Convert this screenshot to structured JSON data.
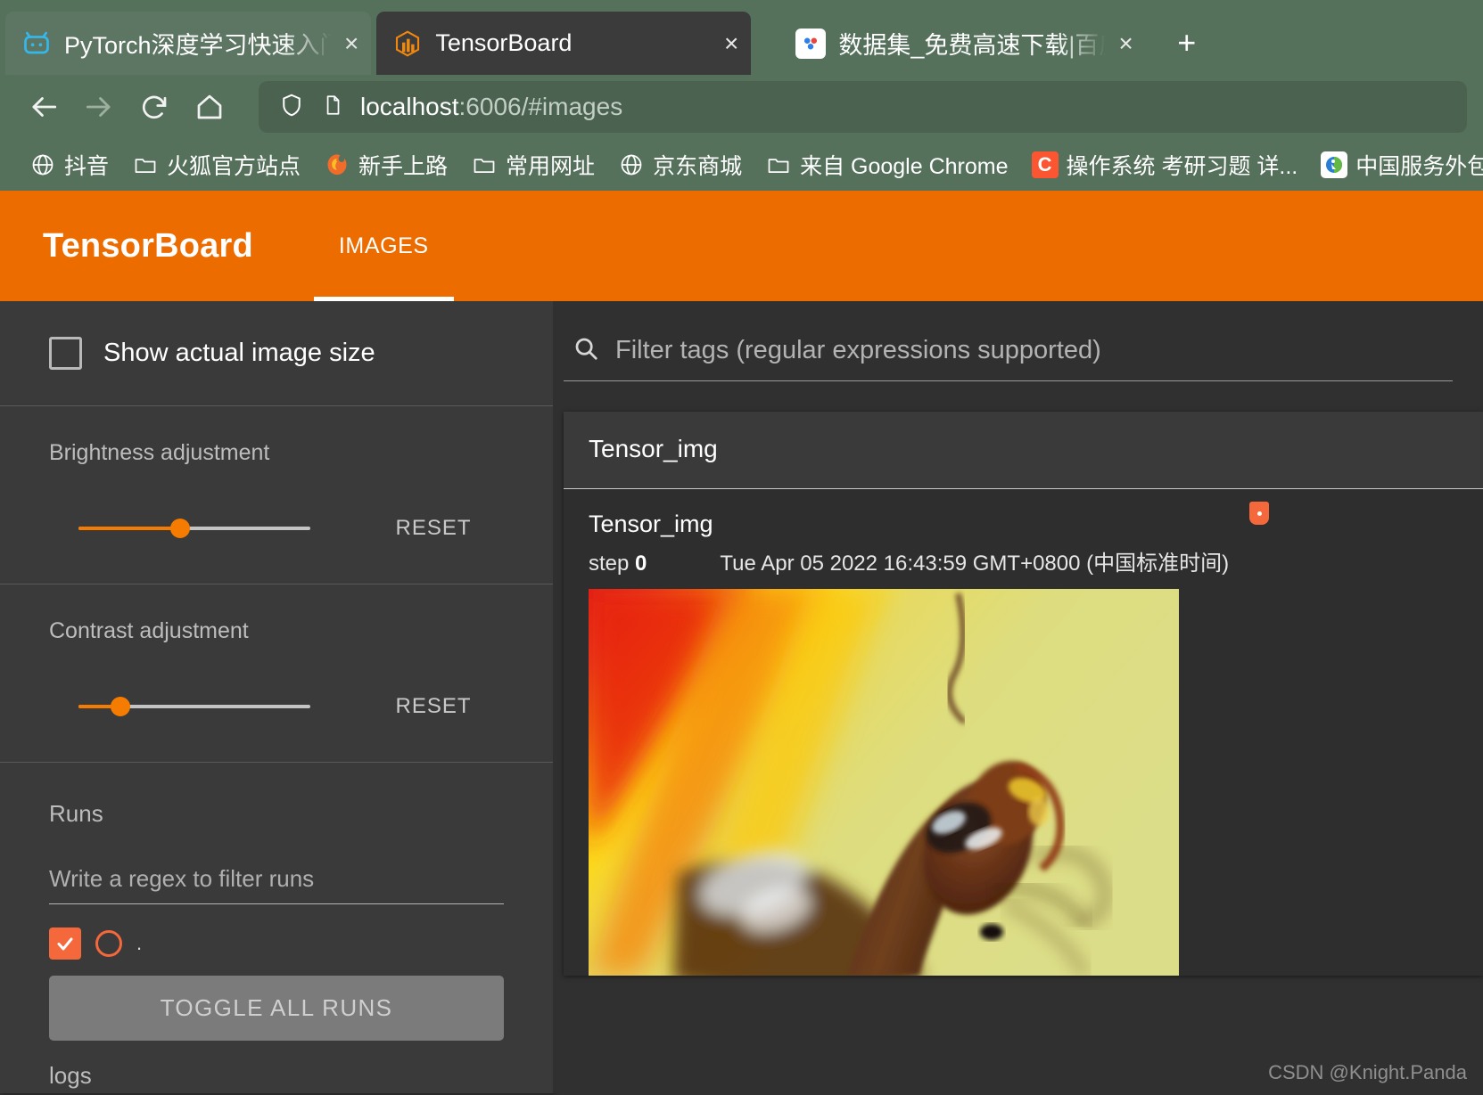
{
  "browser": {
    "tabs": [
      {
        "title": "PyTorch深度学习快速入门教程",
        "favicon": "pytorch-bilibili-icon",
        "state": "inactive",
        "close_label": "×"
      },
      {
        "title": "TensorBoard",
        "favicon": "tensorboard-icon",
        "state": "active",
        "close_label": "×"
      },
      {
        "title": "数据集_免费高速下载|百度网盘",
        "favicon": "baidu-pan-icon",
        "state": "plain",
        "close_label": "×"
      }
    ],
    "new_tab_label": "+",
    "nav": {
      "back": "←",
      "forward": "→",
      "reload": "⟳",
      "home": "⌂"
    },
    "url": {
      "host": "localhost",
      "rest": ":6006/#images"
    },
    "bookmarks": [
      {
        "label": "抖音",
        "icon": "globe-icon"
      },
      {
        "label": "火狐官方站点",
        "icon": "folder-icon"
      },
      {
        "label": "新手上路",
        "icon": "firefox-icon"
      },
      {
        "label": "常用网址",
        "icon": "folder-icon"
      },
      {
        "label": "京东商城",
        "icon": "globe-icon"
      },
      {
        "label": "来自 Google Chrome",
        "icon": "folder-icon"
      },
      {
        "label": "操作系统 考研习题 详...",
        "icon": "csdn-icon"
      },
      {
        "label": "中国服务外包大",
        "icon": "cnsourcing-icon"
      }
    ]
  },
  "tensorboard": {
    "brand": "TensorBoard",
    "tabs": [
      {
        "label": "IMAGES",
        "selected": true
      }
    ],
    "accent_color": "#ec6c00",
    "sidebar": {
      "show_actual_size_label": "Show actual image size",
      "show_actual_size_checked": false,
      "brightness": {
        "title": "Brightness adjustment",
        "reset_label": "RESET",
        "value_pct": 44
      },
      "contrast": {
        "title": "Contrast adjustment",
        "reset_label": "RESET",
        "value_pct": 18
      },
      "runs": {
        "title": "Runs",
        "filter_placeholder": "Write a regex to filter runs",
        "item_label": ".",
        "item_checked": true,
        "toggle_all_label": "TOGGLE ALL RUNS",
        "log_dir": "logs"
      }
    },
    "main": {
      "filter_placeholder": "Filter tags (regular expressions supported)",
      "search_icon": "search-icon",
      "card": {
        "group_title": "Tensor_img",
        "image_title": "Tensor_img",
        "step_label": "step",
        "step_value": "0",
        "timestamp": "Tue Apr 05 2022 16:43:59 GMT+0800 (中国标准时间)",
        "badge_icon": "pin-badge-icon"
      }
    }
  },
  "watermark": "CSDN @Knight.Panda"
}
